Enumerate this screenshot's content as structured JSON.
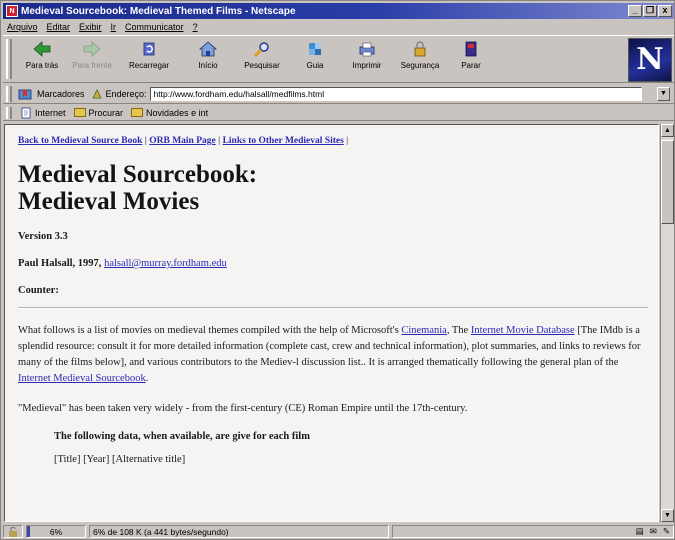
{
  "window": {
    "title": "Medieval Sourcebook: Medieval Themed Films - Netscape",
    "controls": [
      "_",
      "❐",
      "x"
    ]
  },
  "menu": [
    "Arquivo",
    "Editar",
    "Exibir",
    "Ir",
    "Communicator",
    "?"
  ],
  "toolbar": {
    "buttons": [
      {
        "label": "Para trás",
        "icon": "back-arrow-icon",
        "enabled": true
      },
      {
        "label": "Para frente",
        "icon": "forward-arrow-icon",
        "enabled": false
      },
      {
        "label": "Recarregar",
        "icon": "reload-icon",
        "enabled": true
      },
      {
        "label": "Início",
        "icon": "home-icon",
        "enabled": true
      },
      {
        "label": "Pesquisar",
        "icon": "search-icon",
        "enabled": true
      },
      {
        "label": "Guia",
        "icon": "guide-icon",
        "enabled": true
      },
      {
        "label": "Imprimir",
        "icon": "print-icon",
        "enabled": true
      },
      {
        "label": "Segurança",
        "icon": "security-lock-icon",
        "enabled": true
      },
      {
        "label": "Parar",
        "icon": "stop-icon",
        "enabled": true
      }
    ],
    "logo_letter": "N"
  },
  "location": {
    "bookmarks_label": "Marcadores",
    "address_label": "Endereço:",
    "url": "http://www.fordham.edu/halsall/medfilms.html"
  },
  "personal": {
    "items": [
      "Internet",
      "Procurar",
      "Novidades e int"
    ]
  },
  "page": {
    "nav_links": [
      "Back to Medieval Source Book",
      "ORB Main Page",
      "Links to Other Medieval Sites"
    ],
    "title_line1": "Medieval Sourcebook:",
    "title_line2": "Medieval Movies",
    "version": "Version 3.3",
    "author": "Paul Halsall, 1997,",
    "email": "halsall@murray.fordham.edu",
    "counter_label": "Counter:",
    "intro_p1_a": "What follows is a list of movies on medieval themes compiled with the help of Microsoft's ",
    "intro_link_cinemania": "Cinemania",
    "intro_p1_b": ", The ",
    "intro_link_imdb": "Internet Movie Database",
    "intro_p1_c": " [The IMdb is a splendid resource: consult it for more detailed information (complete cast, crew and technical information), plot summaries, and links to reviews for many of the films below], and various contributors to the Mediev-l discussion list.. It is arranged thematically following the general plan of the ",
    "intro_link_ims": "Internet Medieval Sourcebook",
    "intro_p1_d": ".",
    "intro_p2": "\"Medieval\" has been taken very widely - from the first-century (CE) Roman Empire until the 17th-century.",
    "data_heading": "The following data, when available, are give for each film",
    "data_line1": "[Title] [Year] [Alternative title]"
  },
  "status": {
    "percent": "6%",
    "message": "6% de 108 K (a 441 bytes/segundo)",
    "progress_fraction": 0.06
  },
  "colors": {
    "title_bar": "#1a2a8c",
    "link": "#2b2bb5",
    "content_bg": "#f6f4f2"
  }
}
